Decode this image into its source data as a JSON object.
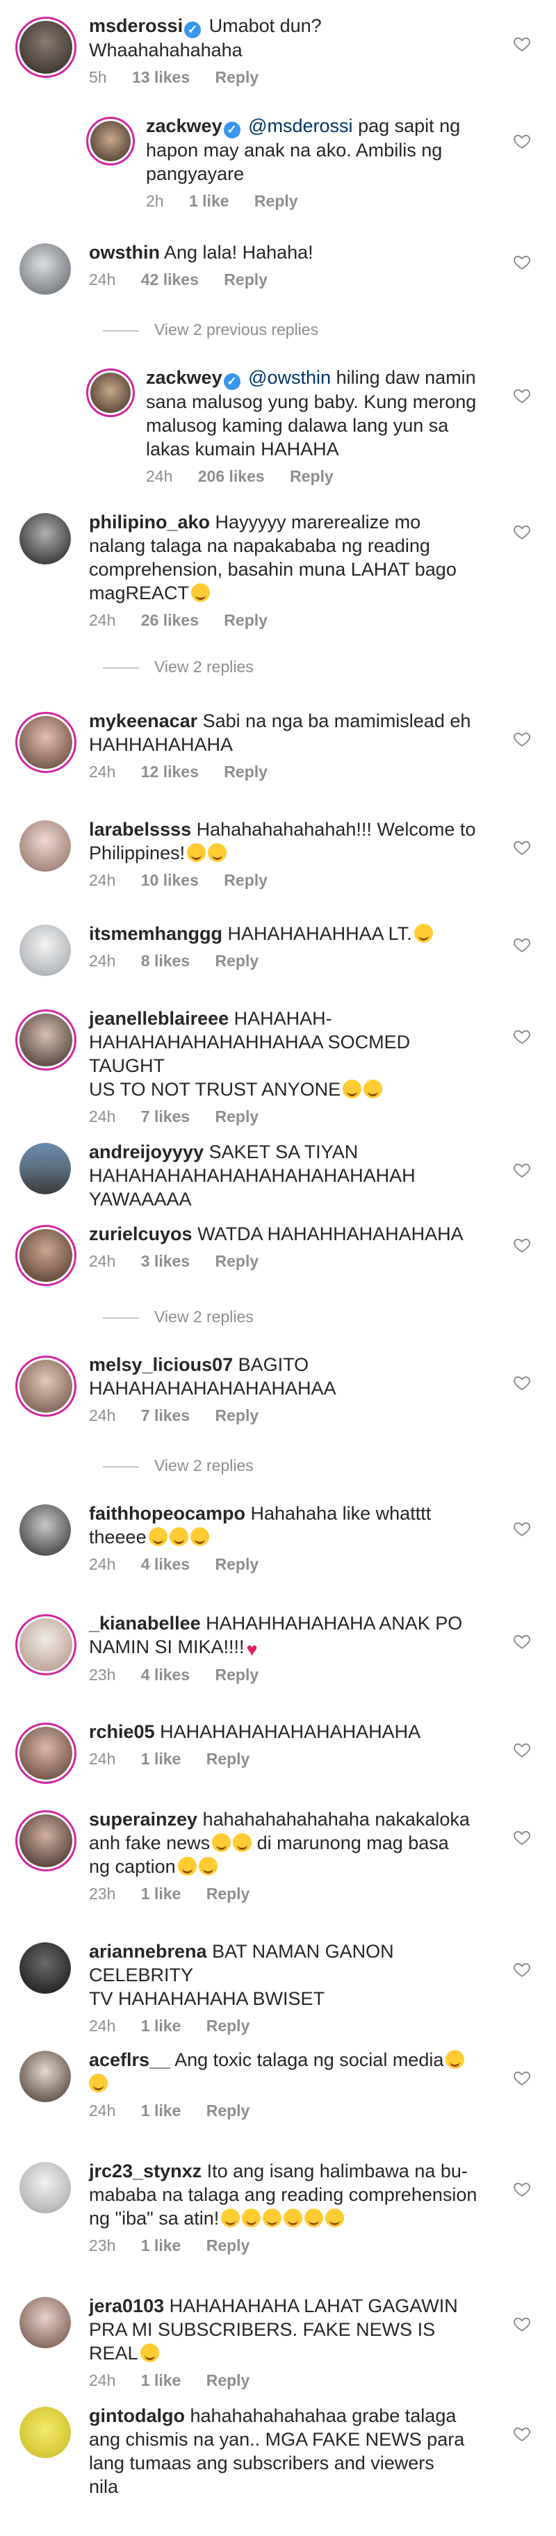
{
  "colors": {
    "text": "#262626",
    "meta": "#8e8e8e",
    "mention": "#003569",
    "verified": "#3897f0",
    "story_ring": "#d6249f"
  },
  "icons": {
    "like": "heart-outline-icon",
    "verified": "verified-badge-icon",
    "emoji_laugh": "laughing-emoji-icon"
  },
  "comments": [
    {
      "username": "msderossi",
      "verified": true,
      "text": "Umabot dun?\nWhaahahahahaha",
      "time": "5h",
      "likes": "13 likes",
      "reply": "Reply"
    },
    {
      "username": "zackwey",
      "verified": true,
      "mention": "@msderossi",
      "text": " pag sapit ng\nhapon may anak na ako. Ambilis ng\npangyayare",
      "time": "2h",
      "likes": "1 like",
      "reply": "Reply"
    },
    {
      "username": "owsthin",
      "text": "Ang lala! Hahaha!",
      "time": "24h",
      "likes": "42 likes",
      "reply": "Reply"
    },
    {
      "username": "zackwey",
      "verified": true,
      "mention": "@owsthin",
      "text": " hiling daw namin\nsana malusog yung baby. Kung merong\nmalusog kaming dalawa lang yun sa\nlakas kumain HAHAHA",
      "time": "24h",
      "likes": "206 likes",
      "reply": "Reply"
    },
    {
      "username": "philipino_ako",
      "text": "Hayyyyy marerealize mo\nnalang talaga na napakababa ng reading\ncomprehension, basahin muna LAHAT bago\nmagREACT",
      "time": "24h",
      "likes": "26 likes",
      "reply": "Reply"
    },
    {
      "username": "mykeenacar",
      "text": "Sabi na nga ba mamimislead eh\nHAHHAHAHAHA",
      "time": "24h",
      "likes": "12 likes",
      "reply": "Reply"
    },
    {
      "username": "larabelssss",
      "text": "Hahahahahahahah!!! Welcome to\nPhilippines!",
      "time": "24h",
      "likes": "10 likes",
      "reply": "Reply"
    },
    {
      "username": "itsmemhanggg",
      "text": "HAHAHAHAHHAA LT.",
      "time": "24h",
      "likes": "8 likes",
      "reply": "Reply"
    },
    {
      "username": "jeanelleblaireee",
      "text": "HAHAHAH-\nHAHAHAHAHAHAHHAHAA SOCMED TAUGHT\nUS TO NOT TRUST ANYONE",
      "time": "24h",
      "likes": "7 likes",
      "reply": "Reply"
    },
    {
      "username": "andreijoyyyy",
      "text": "SAKET SA TIYAN\nHAHAHAHAHAHAHAHAHAHAHAHAH\nYAWAAAAA",
      "time": "",
      "likes": "",
      "reply": ""
    },
    {
      "username": "zurielcuyos",
      "text": "WATDA HAHAHHAHAHAHAHA",
      "time": "24h",
      "likes": "3 likes",
      "reply": "Reply"
    },
    {
      "username": "melsy_licious07",
      "text": "BAGITO\nHAHAHAHAHAHAHAHAHAA",
      "time": "24h",
      "likes": "7 likes",
      "reply": "Reply"
    },
    {
      "username": "faithhopeocampo",
      "text": "Hahahaha like whatttt\ntheeee",
      "time": "24h",
      "likes": "4 likes",
      "reply": "Reply"
    },
    {
      "username": "_kianabellee",
      "text": "HAHAHHAHAHAHA ANAK PO\nNAMIN SI MIKA!!!!",
      "time": "23h",
      "likes": "4 likes",
      "reply": "Reply"
    },
    {
      "username": "rchie05",
      "text": "HAHAHAHAHAHAHAHAHAHA",
      "time": "24h",
      "likes": "1 like",
      "reply": "Reply"
    },
    {
      "username": "superainzey",
      "text": "hahahahahahahaha nakakaloka\nanh fake news",
      "text2": " di marunong mag basa\nng caption",
      "time": "23h",
      "likes": "1 like",
      "reply": "Reply"
    },
    {
      "username": "ariannebrena",
      "text": "BAT NAMAN GANON CELEBRITY\nTV HAHAHAHAHA BWISET",
      "time": "24h",
      "likes": "1 like",
      "reply": "Reply"
    },
    {
      "username": "aceflrs__",
      "text": "Ang toxic talaga ng social media",
      "time": "24h",
      "likes": "1 like",
      "reply": "Reply"
    },
    {
      "username": "jrc23_stynxz",
      "text": "Ito ang isang halimbawa na bu-\nmababa na talaga ang reading comprehension\nng \"iba\" sa atin!",
      "time": "23h",
      "likes": "1 like",
      "reply": "Reply"
    },
    {
      "username": "jera0103",
      "text": "HAHAHAHAHA LAHAT GAGAWIN\nPRA MI SUBSCRIBERS. FAKE NEWS IS REAL",
      "time": "24h",
      "likes": "1 like",
      "reply": "Reply"
    },
    {
      "username": "gintodalgo",
      "text": "hahahahahahahaa grabe talaga\nang chismis na yan.. MGA FAKE NEWS para\nlang tumaas ang subscribers and viewers\nnila",
      "time": "",
      "likes": "",
      "reply": ""
    }
  ],
  "view_replies": [
    {
      "label": "View 2 previous replies"
    },
    {
      "label": "View 2 replies"
    },
    {
      "label": "View 2 replies"
    },
    {
      "label": "View 2 replies"
    }
  ]
}
